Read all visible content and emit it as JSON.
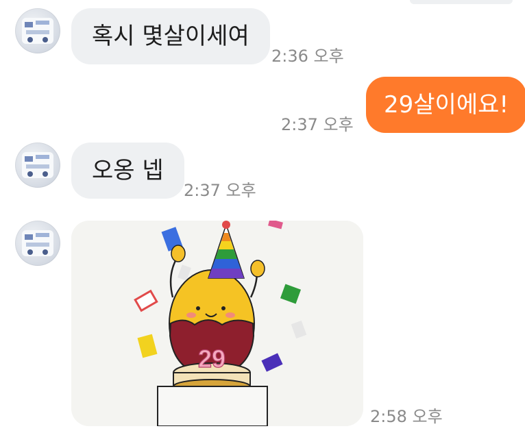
{
  "messages": [
    {
      "side": "in",
      "text": "혹시 몇살이세여",
      "time": "2:36 오후"
    },
    {
      "side": "out",
      "text": "29살이에요!",
      "time": "2:37 오후"
    },
    {
      "side": "in",
      "text": "오옹 넵",
      "time": "2:37 오후"
    },
    {
      "side": "in",
      "type": "image",
      "time": "2:58 오후",
      "cake_number": "29"
    }
  ],
  "colors": {
    "incoming_bubble": "#eef0f2",
    "outgoing_bubble": "#ff7a2b",
    "timestamp": "#8a8a8a"
  }
}
